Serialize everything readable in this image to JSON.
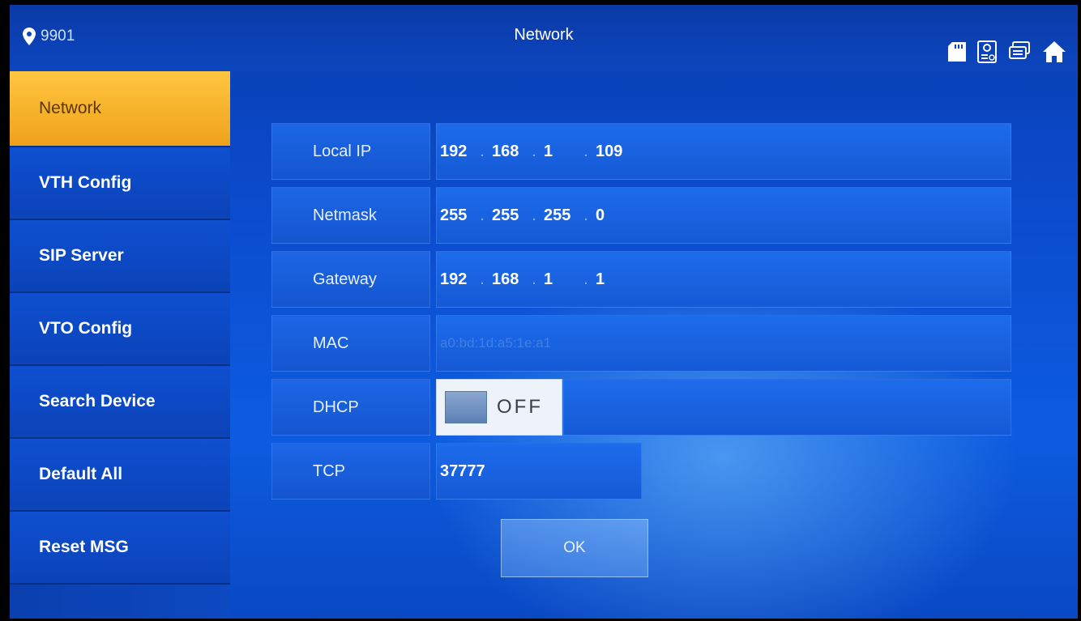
{
  "header": {
    "location_id": "9901",
    "title": "Network",
    "icons": [
      "sd-card-icon",
      "contact-card-icon",
      "message-stack-icon",
      "home-icon"
    ]
  },
  "sidebar": {
    "items": [
      {
        "label": "Network",
        "active": true
      },
      {
        "label": "VTH Config"
      },
      {
        "label": "SIP Server"
      },
      {
        "label": "VTO Config"
      },
      {
        "label": "Search Device"
      },
      {
        "label": "Default All"
      },
      {
        "label": "Reset MSG"
      }
    ]
  },
  "form": {
    "local_ip": {
      "label": "Local IP",
      "octets": [
        "192",
        "168",
        "1",
        "109"
      ]
    },
    "netmask": {
      "label": "Netmask",
      "octets": [
        "255",
        "255",
        "255",
        "0"
      ]
    },
    "gateway": {
      "label": "Gateway",
      "octets": [
        "192",
        "168",
        "1",
        "1"
      ]
    },
    "mac": {
      "label": "MAC",
      "value": "a0:bd:1d:a5:1e:a1"
    },
    "dhcp": {
      "label": "DHCP",
      "state": "OFF"
    },
    "tcp": {
      "label": "TCP",
      "value": "37777"
    },
    "ok_label": "OK"
  },
  "colors": {
    "accent_active": "#f5ad24",
    "background": "#0d55dc"
  }
}
